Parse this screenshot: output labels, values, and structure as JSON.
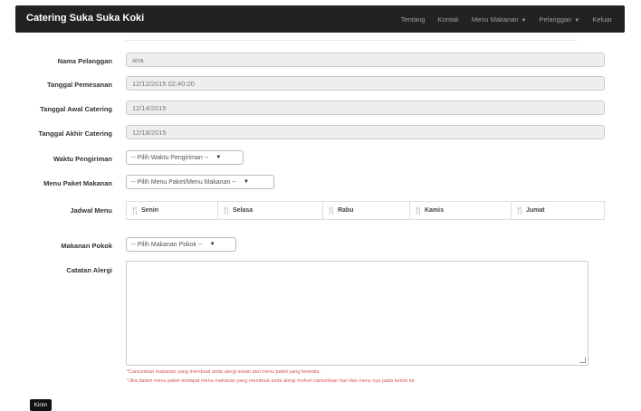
{
  "app": {
    "title": "Catering Suka Suka Koki"
  },
  "nav": {
    "items": [
      {
        "label": "Tentang",
        "dropdown": false
      },
      {
        "label": "Kontak",
        "dropdown": false
      },
      {
        "label": "Menu Makanan",
        "dropdown": true
      },
      {
        "label": "Pelanggan",
        "dropdown": true
      },
      {
        "label": "Keluar",
        "dropdown": false
      }
    ]
  },
  "form": {
    "nama_pelanggan": {
      "label": "Nama Pelanggan",
      "value": "ana"
    },
    "tanggal_pemesanan": {
      "label": "Tanggal Pemesanan",
      "value": "12/12/2015 02:40:20"
    },
    "tanggal_awal": {
      "label": "Tanggal Awal Catering",
      "value": "12/14/2015"
    },
    "tanggal_akhir": {
      "label": "Tanggal Akhir Catering",
      "value": "12/18/2015"
    },
    "waktu_pengiriman": {
      "label": "Waktu Pengiriman",
      "selected": "-- Pilih Waktu Pengiriman --"
    },
    "menu_paket": {
      "label": "Menu Paket Makanan",
      "selected": "-- Pilih Menu Paket/Menu Makanan --"
    },
    "jadwal_menu": {
      "label": "Jadwal Menu",
      "days": [
        "Senin",
        "Selasa",
        "Rabu",
        "Kamis",
        "Jumat"
      ]
    },
    "makanan_pokok": {
      "label": "Makanan Pokok",
      "selected": "-- Pilih Makanan Pokok --"
    },
    "catatan_alergi": {
      "label": "Catatan Alergi",
      "value": "",
      "notes": [
        "*Cantumkan makanan yang membuat anda alergi selain dari menu paket yang tersedia.",
        "*Jika dalam menu paket terdapat menu makanan yang membuat anda alergi mohon cantumkan hari dan menu nya pada kolom ini."
      ]
    },
    "submit_label": "Kirim"
  },
  "colors": {
    "navbar": "#222222",
    "note": "#d9534f",
    "button": "#111111"
  },
  "icons": {
    "dropdown": "caret-down-icon",
    "schedule": "fork-knife-icon",
    "select": "triangle-down-icon"
  }
}
